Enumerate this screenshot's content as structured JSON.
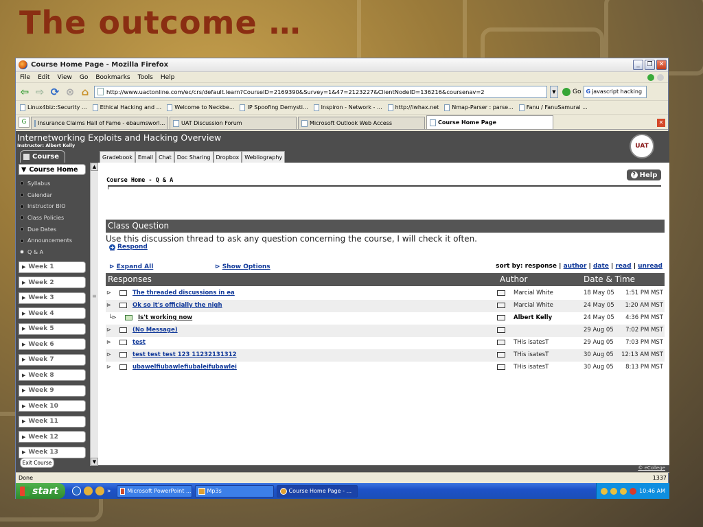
{
  "slide": {
    "title": "The outcome …"
  },
  "window": {
    "title": "Course Home Page - Mozilla Firefox",
    "menu": [
      "File",
      "Edit",
      "View",
      "Go",
      "Bookmarks",
      "Tools",
      "Help"
    ],
    "url": "http://www.uactonline.com/ec/crs/default.learn?CourseID=2169390&Survey=1&47=2123227&ClientNodeID=136216&coursenav=2",
    "go_label": "Go",
    "search_value": "javascript hacking",
    "bookmarks": [
      "Linux4biz::Security ...",
      "Ethical Hacking and ...",
      "Welcome to Neckbe...",
      "IP Spoofing Demysti...",
      "Inspiron - Network - ...",
      "http://iwhax.net",
      "Nmap-Parser : parse...",
      "Fanu / FanuSamurai ..."
    ],
    "tabs": [
      "Insurance Claims Hall of Fame - ebaumsworl...",
      "UAT Discussion Forum",
      "Microsoft Outlook Web Access",
      "Course Home Page"
    ],
    "status_left": "Done",
    "status_right": "1337"
  },
  "course": {
    "title": "Internetworking Exploits and Hacking Overview",
    "instructor": "Instructor: Albert Kelly",
    "logo_text": "UAT",
    "tab_label": "Course",
    "subtabs": [
      "Gradebook",
      "Email",
      "Chat",
      "Doc Sharing",
      "Dropbox",
      "Webliography"
    ],
    "sidebar": {
      "head": "Course Home",
      "links": [
        "Syllabus",
        "Calendar",
        "Instructor BIO",
        "Class Policies",
        "Due Dates",
        "Announcements",
        "Q & A"
      ],
      "weeks": [
        "Week 1",
        "Week 2",
        "Week 3",
        "Week 4",
        "Week 5",
        "Week 6",
        "Week 7",
        "Week 8",
        "Week 9",
        "Week 10",
        "Week 11",
        "Week 12",
        "Week 13"
      ],
      "exit": "Exit Course"
    },
    "footer_link": "© eCollege"
  },
  "main": {
    "help_label": "Help",
    "page_title": "Course Home - Q & A",
    "section_title": "Class Question",
    "description": "Use this discussion thread to ask any question concerning the course, I will check it often.",
    "respond": "Respond",
    "expand_all": "Expand All",
    "show_options": "Show Options",
    "sort_label": "sort by: response |",
    "sort_author": "author",
    "sort_date": "date",
    "sort_read": "read",
    "sort_unread": "unread",
    "sort_sep": "|",
    "col_responses": "Responses",
    "col_author": "Author",
    "col_datetime": "Date & Time",
    "rows": [
      {
        "subject": "The threaded discussions in ea",
        "author": "Marcial White",
        "date": "18 May 05",
        "time": "1:51 PM MST"
      },
      {
        "subject": "Ok so it's officially the nigh",
        "author": "Marcial White",
        "date": "24 May 05",
        "time": "1:20 AM MST"
      },
      {
        "subject": "Is't working now",
        "author": "Albert Kelly",
        "date": "24 May 05",
        "time": "4:36 PM MST"
      },
      {
        "subject": "(No Message)",
        "author": "",
        "date": "29 Aug 05",
        "time": "7:02 PM MST"
      },
      {
        "subject": "test",
        "author": "THis isatesT",
        "date": "29 Aug 05",
        "time": "7:03 PM MST"
      },
      {
        "subject": "test test test 123 11232131312",
        "author": "THis isatesT",
        "date": "30 Aug 05",
        "time": "12:13 AM MST"
      },
      {
        "subject": "ubawelfiubawlefiubaleifubawlei",
        "author": "THis isatesT",
        "date": "30 Aug 05",
        "time": "8:13 PM MST"
      }
    ]
  },
  "taskbar": {
    "start": "start",
    "buttons": [
      "Microsoft PowerPoint ...",
      "Mp3s",
      "Course Home Page - ..."
    ],
    "clock": "10:46 AM"
  }
}
